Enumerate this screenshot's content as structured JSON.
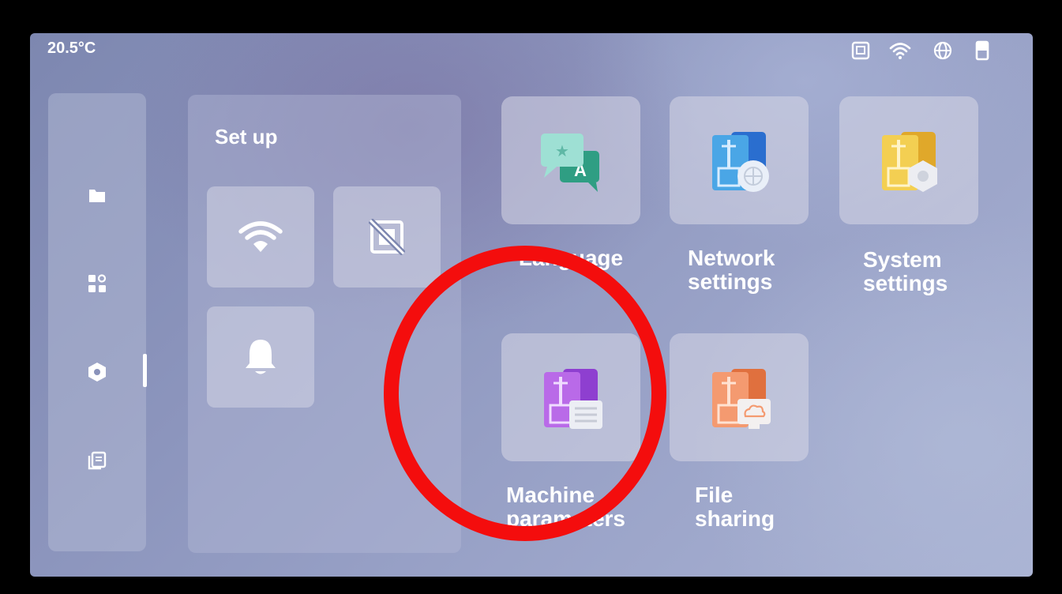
{
  "status_bar": {
    "temperature": "20.5°C",
    "icons": [
      "screen-icon",
      "wifi-icon",
      "globe-icon",
      "usb-icon"
    ]
  },
  "sidebar": {
    "items": [
      {
        "icon": "folder-icon"
      },
      {
        "icon": "apps-icon"
      },
      {
        "icon": "settings-hex-icon",
        "active": true
      },
      {
        "icon": "log-icon"
      }
    ]
  },
  "setup_panel": {
    "title": "Set up",
    "quick_tiles": [
      {
        "icon": "wifi-icon"
      },
      {
        "icon": "screen-off-icon"
      },
      {
        "icon": "bell-icon"
      }
    ]
  },
  "apps": [
    {
      "label": "Language",
      "icon": "language-icon"
    },
    {
      "label_lines": [
        "Network",
        "settings"
      ],
      "icon": "network-settings-icon"
    },
    {
      "label_lines": [
        "System",
        "settings"
      ],
      "icon": "system-settings-icon"
    },
    {
      "label_lines": [
        "Machine",
        "parameters"
      ],
      "icon": "machine-parameters-icon"
    },
    {
      "label_lines": [
        "File",
        "sharing"
      ],
      "icon": "file-sharing-icon"
    }
  ],
  "annotation": {
    "color": "#f40d0d"
  }
}
